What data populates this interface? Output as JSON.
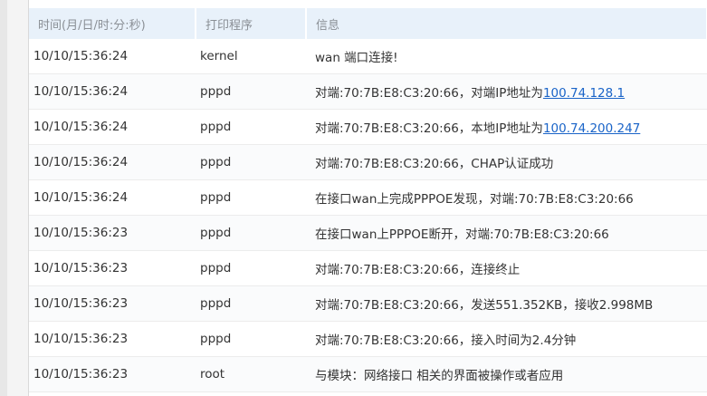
{
  "table": {
    "headers": {
      "time": "时间(月/日/时:分:秒)",
      "program": "打印程序",
      "message": "信息"
    },
    "rows": [
      {
        "time": "10/10/15:36:24",
        "program": "kernel",
        "message": "wan 端口连接!",
        "link": ""
      },
      {
        "time": "10/10/15:36:24",
        "program": "pppd",
        "message": "对端:70:7B:E8:C3:20:66，对端IP地址为",
        "link": "100.74.128.1"
      },
      {
        "time": "10/10/15:36:24",
        "program": "pppd",
        "message": "对端:70:7B:E8:C3:20:66，本地IP地址为",
        "link": "100.74.200.247"
      },
      {
        "time": "10/10/15:36:24",
        "program": "pppd",
        "message": "对端:70:7B:E8:C3:20:66，CHAP认证成功",
        "link": ""
      },
      {
        "time": "10/10/15:36:24",
        "program": "pppd",
        "message": "在接口wan上完成PPPOE发现，对端:70:7B:E8:C3:20:66",
        "link": ""
      },
      {
        "time": "10/10/15:36:23",
        "program": "pppd",
        "message": "在接口wan上PPPOE断开，对端:70:7B:E8:C3:20:66",
        "link": ""
      },
      {
        "time": "10/10/15:36:23",
        "program": "pppd",
        "message": "对端:70:7B:E8:C3:20:66，连接终止",
        "link": ""
      },
      {
        "time": "10/10/15:36:23",
        "program": "pppd",
        "message": "对端:70:7B:E8:C3:20:66，发送551.352KB，接收2.998MB",
        "link": ""
      },
      {
        "time": "10/10/15:36:23",
        "program": "pppd",
        "message": "对端:70:7B:E8:C3:20:66，接入时间为2.4分钟",
        "link": ""
      },
      {
        "time": "10/10/15:36:23",
        "program": "root",
        "message": "与模块：网络接口 相关的界面被操作或者应用",
        "link": ""
      }
    ]
  }
}
